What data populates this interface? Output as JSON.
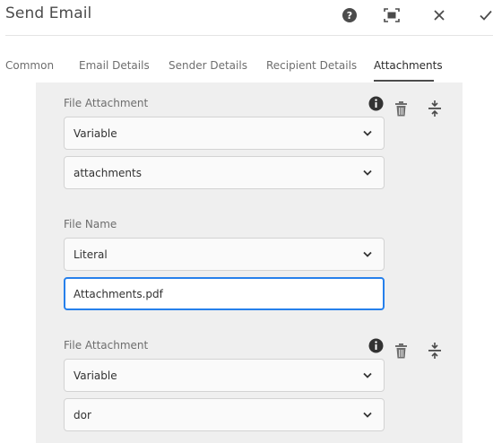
{
  "window": {
    "title": "Send Email"
  },
  "header_icons": {
    "help": "help-icon",
    "fullscreen": "fullscreen-icon",
    "close": "close-icon",
    "done": "checkmark-icon"
  },
  "tabs": [
    {
      "label": "Common"
    },
    {
      "label": "Email Details"
    },
    {
      "label": "Sender Details"
    },
    {
      "label": "Recipient Details"
    },
    {
      "label": "Attachments",
      "active": true
    }
  ],
  "attachments": [
    {
      "label": "File Attachment",
      "type_value": "Variable",
      "source_value": "attachments"
    },
    {
      "label": "File Attachment",
      "type_value": "Variable",
      "source_value": "dor"
    }
  ],
  "file_name": {
    "label": "File Name",
    "type_value": "Literal",
    "value": "Attachments.pdf"
  },
  "colors": {
    "focus": "#2680eb",
    "panel": "#efefef"
  }
}
